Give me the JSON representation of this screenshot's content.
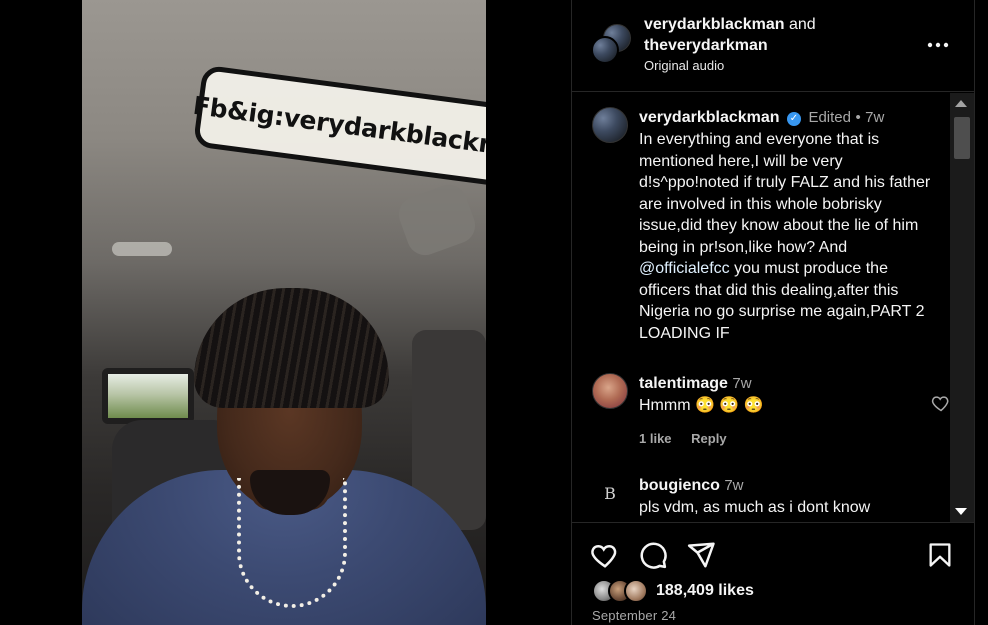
{
  "video": {
    "caption": "Fb&ig:verydarkblackman"
  },
  "header": {
    "user1": "verydarkblackman",
    "joiner": "and",
    "user2": "theverydarkman",
    "audio": "Original audio",
    "more_icon": "more-horizontal-icon"
  },
  "comments": [
    {
      "user": "verydarkblackman",
      "verified": true,
      "edited": "Edited",
      "dot": "•",
      "age": "7w",
      "text_before_mention": "In everything and everyone that is mentioned here,I will be very d!s^ppo!noted if truly FALZ and his father are involved in this whole bobrisky issue,did they know about the lie of him being in pr!son,like how? And ",
      "mention": "@officialefcc",
      "text_after_mention": " you must produce the officers that did this dealing,after this Nigeria no go surprise me again,PART 2 LOADING IF"
    },
    {
      "user": "talentimage",
      "age": "7w",
      "text": "Hmmm 😳 😳 😳",
      "likes": "1 like",
      "reply": "Reply"
    },
    {
      "user": "bougienco",
      "avatar_letter": "B",
      "age": "7w",
      "text": "pls vdm, as much as i dont know"
    }
  ],
  "action_bar": {
    "likes": "188,409 likes",
    "date": "September 24"
  },
  "colors": {
    "background": "#000000",
    "text": "#f5f5f5",
    "muted": "#a8a8a8",
    "verified": "#3897f0",
    "divider": "#262626"
  }
}
